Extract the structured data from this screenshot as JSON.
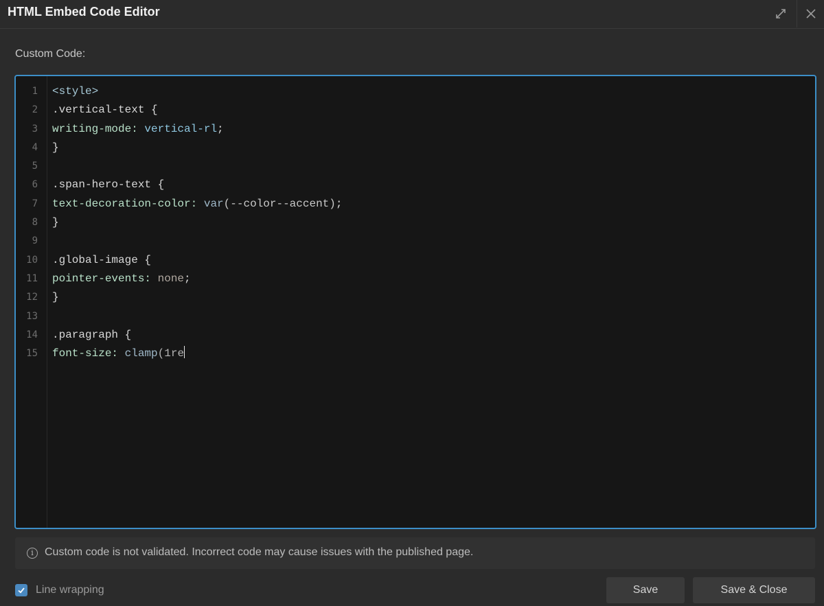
{
  "dialog": {
    "title": "HTML Embed Code Editor",
    "expand_icon": "expand-diagonal-icon",
    "close_icon": "close-x-icon"
  },
  "editor": {
    "label": "Custom Code:",
    "lines": [
      {
        "num": "1",
        "tokens": [
          {
            "t": "<style>",
            "c": "tag"
          }
        ]
      },
      {
        "num": "2",
        "tokens": [
          {
            "t": ".vertical-text {",
            "c": "sel"
          }
        ]
      },
      {
        "num": "3",
        "tokens": [
          {
            "t": "writing-mode: ",
            "c": "prop"
          },
          {
            "t": "vertical-rl",
            "c": "val"
          },
          {
            "t": ";",
            "c": "brace"
          }
        ]
      },
      {
        "num": "4",
        "tokens": [
          {
            "t": "}",
            "c": "brace"
          }
        ]
      },
      {
        "num": "5",
        "tokens": []
      },
      {
        "num": "6",
        "tokens": [
          {
            "t": ".span-hero-text {",
            "c": "sel"
          }
        ]
      },
      {
        "num": "7",
        "tokens": [
          {
            "t": "text-decoration-color: ",
            "c": "prop"
          },
          {
            "t": "var",
            "c": "fn"
          },
          {
            "t": "(--color--accent)",
            "c": "var"
          },
          {
            "t": ";",
            "c": "brace"
          }
        ]
      },
      {
        "num": "8",
        "tokens": [
          {
            "t": "}",
            "c": "brace"
          }
        ]
      },
      {
        "num": "9",
        "tokens": []
      },
      {
        "num": "10",
        "tokens": [
          {
            "t": ".global-image {",
            "c": "sel"
          }
        ]
      },
      {
        "num": "11",
        "tokens": [
          {
            "t": "pointer-events: ",
            "c": "prop"
          },
          {
            "t": "none",
            "c": "kw"
          },
          {
            "t": ";",
            "c": "brace"
          }
        ]
      },
      {
        "num": "12",
        "tokens": [
          {
            "t": "}",
            "c": "brace"
          }
        ]
      },
      {
        "num": "13",
        "tokens": []
      },
      {
        "num": "14",
        "tokens": [
          {
            "t": ".paragraph {",
            "c": "sel"
          }
        ]
      },
      {
        "num": "15",
        "tokens": [
          {
            "t": "font-size: ",
            "c": "prop"
          },
          {
            "t": "clamp",
            "c": "fn"
          },
          {
            "t": "(1re",
            "c": "partial"
          }
        ],
        "cursor": true
      }
    ]
  },
  "notice": {
    "icon": "info-circle-icon",
    "text": "Custom code is not validated. Incorrect code may cause issues with the published page."
  },
  "footer": {
    "line_wrapping_label": "Line wrapping",
    "line_wrapping_checked": true,
    "save_label": "Save",
    "save_close_label": "Save & Close"
  },
  "colors": {
    "accent_border": "#3c8fc8",
    "checkbox": "#4a89c0"
  }
}
